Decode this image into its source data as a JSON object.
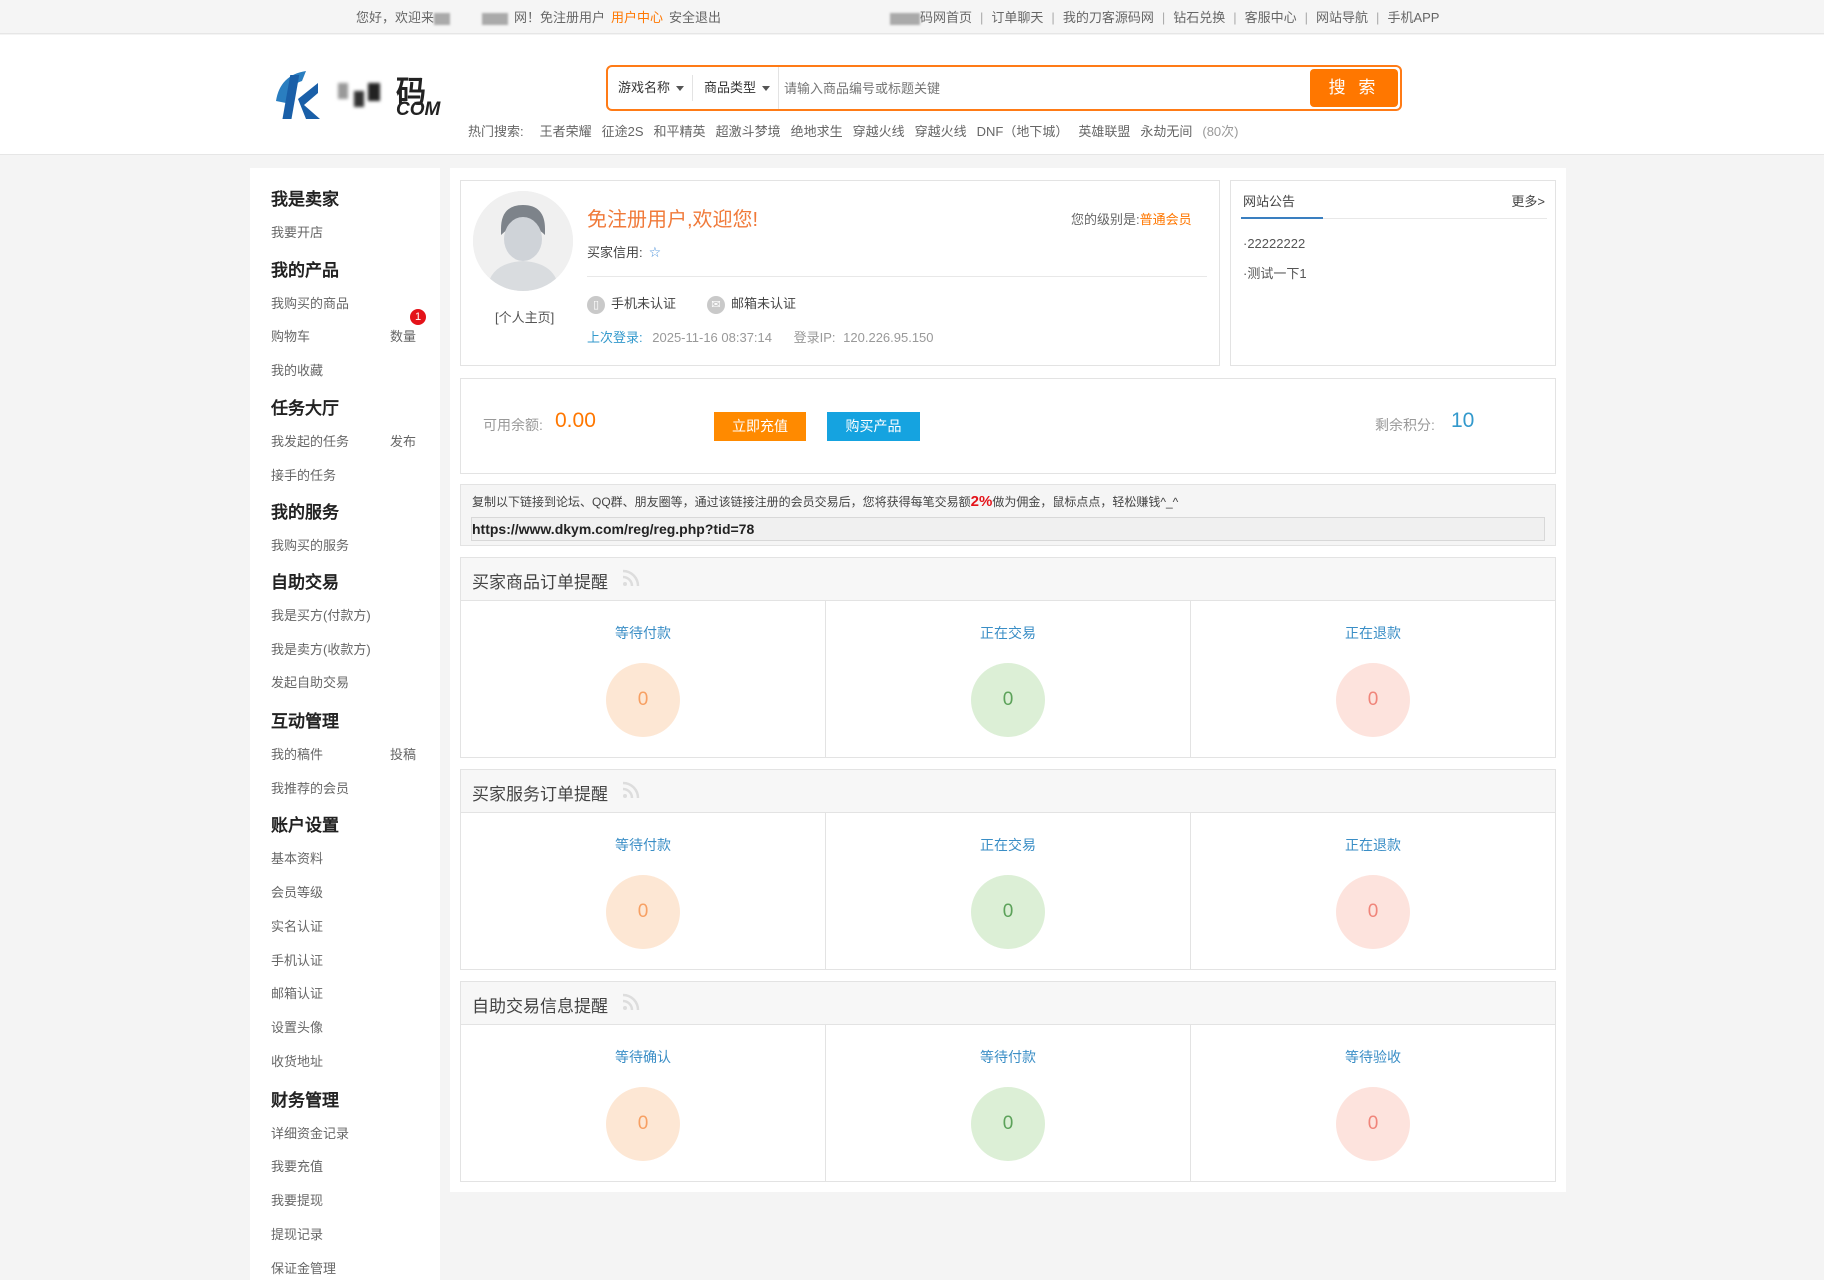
{
  "topbar": {
    "greeting": "您好，欢迎来",
    "site_suffix": "网！免注册用户",
    "user_center": "用户中心",
    "logout": "安全退出",
    "nav": [
      "码网首页",
      "订单聊天",
      "我的刀客源码网",
      "钻石兑换",
      "客服中心",
      "网站导航",
      "手机APP"
    ]
  },
  "header": {
    "logo_text_top": "码",
    "logo_text_bottom": "COM",
    "search": {
      "game_dropdown": "游戏名称",
      "type_dropdown": "商品类型",
      "placeholder": "请输入商品编号或标题关键",
      "button": "搜 索"
    },
    "hot": {
      "label": "热门搜索:",
      "items": [
        "王者荣耀",
        "征途2S",
        "和平精英",
        "超激斗梦境",
        "绝地求生",
        "穿越火线",
        "穿越火线",
        "DNF（地下城）",
        "英雄联盟",
        "永劫无间"
      ],
      "count": "(80次)"
    }
  },
  "sidebar": {
    "groups": [
      {
        "title": "我是卖家",
        "items": [
          {
            "label": "我要开店"
          }
        ]
      },
      {
        "title": "我的产品",
        "items": [
          {
            "label": "我购买的商品"
          },
          {
            "label": "购物车",
            "right": "数量",
            "badge": "1"
          },
          {
            "label": "我的收藏"
          }
        ]
      },
      {
        "title": "任务大厅",
        "items": [
          {
            "label": "我发起的任务",
            "right": "发布"
          },
          {
            "label": "接手的任务"
          }
        ]
      },
      {
        "title": "我的服务",
        "items": [
          {
            "label": "我购买的服务"
          }
        ]
      },
      {
        "title": "自助交易",
        "items": [
          {
            "label": "我是买方(付款方)"
          },
          {
            "label": "我是卖方(收款方)"
          },
          {
            "label": "发起自助交易"
          }
        ]
      },
      {
        "title": "互动管理",
        "items": [
          {
            "label": "我的稿件",
            "right": "投稿"
          },
          {
            "label": "我推荐的会员"
          }
        ]
      },
      {
        "title": "账户设置",
        "items": [
          {
            "label": "基本资料"
          },
          {
            "label": "会员等级"
          },
          {
            "label": "实名认证"
          },
          {
            "label": "手机认证"
          },
          {
            "label": "邮箱认证"
          },
          {
            "label": "设置头像"
          },
          {
            "label": "收货地址"
          }
        ]
      },
      {
        "title": "财务管理",
        "items": [
          {
            "label": "详细资金记录"
          },
          {
            "label": "我要充值"
          },
          {
            "label": "我要提现"
          },
          {
            "label": "提现记录"
          },
          {
            "label": "保证金管理"
          }
        ]
      }
    ]
  },
  "profile": {
    "home_link": "[个人主页]",
    "welcome": "免注册用户,欢迎您!",
    "level_label": "您的级别是:",
    "level_value": "普通会员",
    "credit_label": "买家信用:",
    "phone_status": "手机未认证",
    "email_status": "邮箱未认证",
    "last_login_label": "上次登录:",
    "last_login_time": "2025-11-16 08:37:14",
    "login_ip_label": "登录IP:",
    "login_ip": "120.226.95.150"
  },
  "notice": {
    "title": "网站公告",
    "more": "更多>",
    "items": [
      "·22222222",
      "·测试一下1"
    ]
  },
  "balance": {
    "label": "可用余额:",
    "value": "0.00",
    "recharge_button": "立即充值",
    "buy_button": "购买产品",
    "points_label": "剩余积分:",
    "points_value": "10"
  },
  "referral": {
    "text_before": "复制以下链接到论坛、QQ群、朋友圈等，通过该链接注册的会员交易后，您将获得每笔交易额",
    "percent": "2%",
    "text_after": "做为佣金，鼠标点点，轻松赚钱^_^",
    "link": "https://www.dkym.com/reg/reg.php?tid=78"
  },
  "sections": [
    {
      "title": "买家商品订单提醒",
      "cols": [
        {
          "label": "等待付款",
          "value": "0"
        },
        {
          "label": "正在交易",
          "value": "0"
        },
        {
          "label": "正在退款",
          "value": "0"
        }
      ]
    },
    {
      "title": "买家服务订单提醒",
      "cols": [
        {
          "label": "等待付款",
          "value": "0"
        },
        {
          "label": "正在交易",
          "value": "0"
        },
        {
          "label": "正在退款",
          "value": "0"
        }
      ]
    },
    {
      "title": "自助交易信息提醒",
      "cols": [
        {
          "label": "等待确认",
          "value": "0"
        },
        {
          "label": "等待付款",
          "value": "0"
        },
        {
          "label": "等待验收",
          "value": "0"
        }
      ]
    }
  ],
  "colors": {
    "accent_orange": "#ff7700",
    "link_blue": "#3399cc",
    "button_blue": "#15a3e0"
  }
}
